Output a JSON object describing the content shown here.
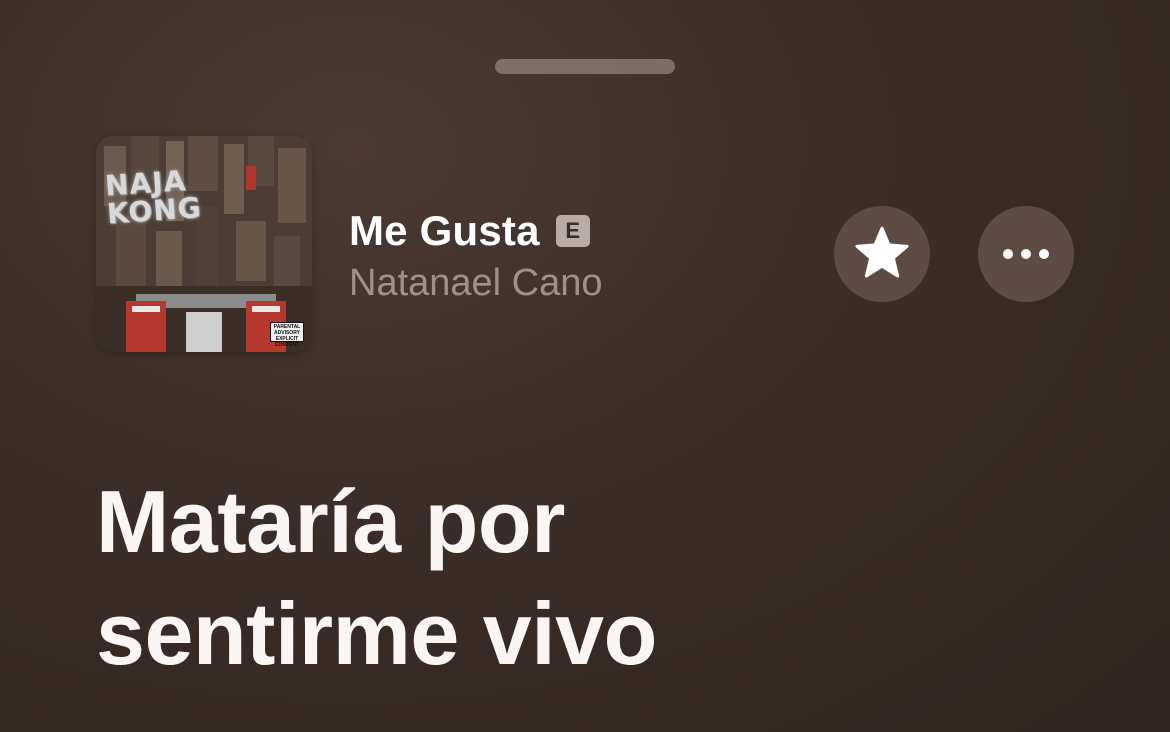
{
  "now_playing": {
    "song_title": "Me Gusta",
    "explicit_badge": "E",
    "artist": "Natanael Cano",
    "artwork": {
      "title_text": "NAJA\nKONG",
      "advisory_text": "PARENTAL ADVISORY EXPLICIT CONTENT"
    }
  },
  "controls": {
    "favorite_icon": "star-icon",
    "more_icon": "ellipsis-icon"
  },
  "lyrics": {
    "line_1": "Mataría por",
    "line_2": "sentirme vivo"
  },
  "colors": {
    "background": "#3b2d27",
    "button": "#5c4c45",
    "title": "#ffffff",
    "artist": "#9f908a"
  }
}
